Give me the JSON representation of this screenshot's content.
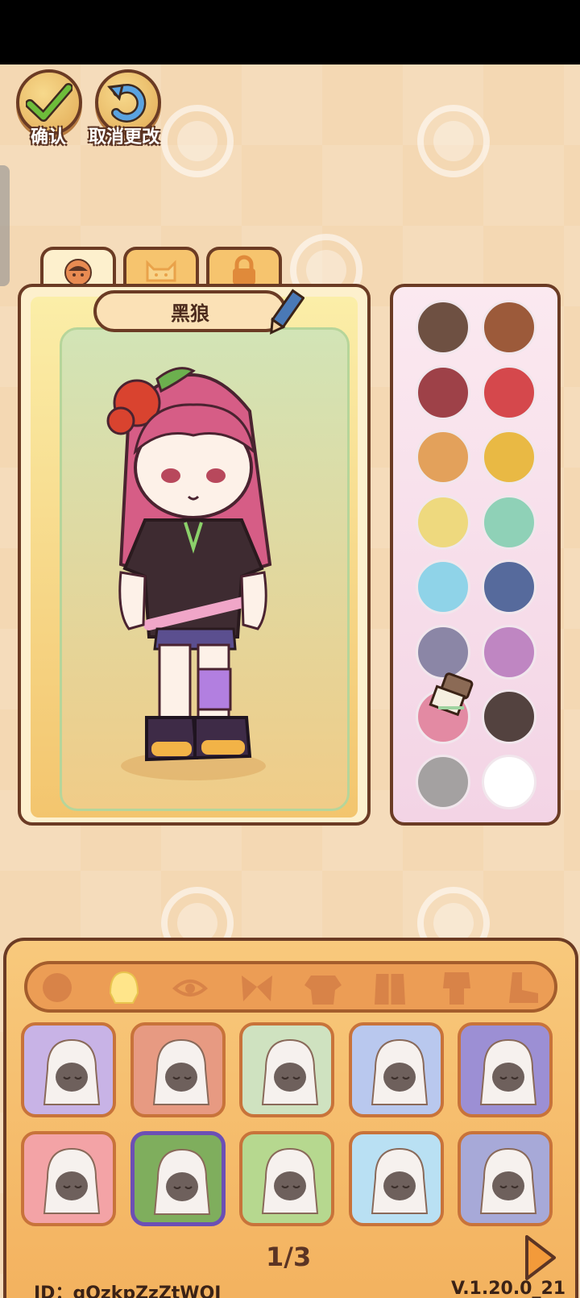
{
  "top_buttons": {
    "confirm_label": "确认",
    "undo_label": "取消更改"
  },
  "tabs": [
    {
      "name": "character-tab",
      "icon": "face-icon",
      "active": true
    },
    {
      "name": "pet-tab",
      "icon": "cat-icon",
      "active": false
    },
    {
      "name": "locked-tab",
      "icon": "lock-icon",
      "active": false
    }
  ],
  "character": {
    "name": "黑狼"
  },
  "palette": {
    "colors": [
      "#6e5042",
      "#9c5a3a",
      "#9e4148",
      "#d5484c",
      "#e3a15b",
      "#e9b944",
      "#eed97e",
      "#8fd1b7",
      "#8fd3e8",
      "#566a9c",
      "#8b86a6",
      "#bf86c2",
      "#e38aa3",
      "#53423f",
      "#a4a1a1",
      "#ffffff"
    ]
  },
  "categories": [
    {
      "name": "head-icon",
      "active": false
    },
    {
      "name": "hair-icon",
      "active": true
    },
    {
      "name": "eye-icon",
      "active": false
    },
    {
      "name": "bow-icon",
      "active": false
    },
    {
      "name": "shirt-icon",
      "active": false
    },
    {
      "name": "coat-icon",
      "active": false
    },
    {
      "name": "outfit-icon",
      "active": false
    },
    {
      "name": "shoe-icon",
      "active": false
    }
  ],
  "items": [
    {
      "bg": "#c8b3e6",
      "selected": false
    },
    {
      "bg": "#e79a82",
      "selected": false
    },
    {
      "bg": "#cfe2c0",
      "selected": false
    },
    {
      "bg": "#b9c8ee",
      "selected": false
    },
    {
      "bg": "#9c8fd4",
      "selected": false
    },
    {
      "bg": "#f3a3a6",
      "selected": false
    },
    {
      "bg": "#7fae5d",
      "selected": true
    },
    {
      "bg": "#b6d88f",
      "selected": false
    },
    {
      "bg": "#b9e0f3",
      "selected": false
    },
    {
      "bg": "#a7a9d8",
      "selected": false
    }
  ],
  "pagination": {
    "page": "1/3"
  },
  "footer": {
    "id": "ID：gQzkpZzZtWOJ",
    "version": "V.1.20.0_21"
  }
}
